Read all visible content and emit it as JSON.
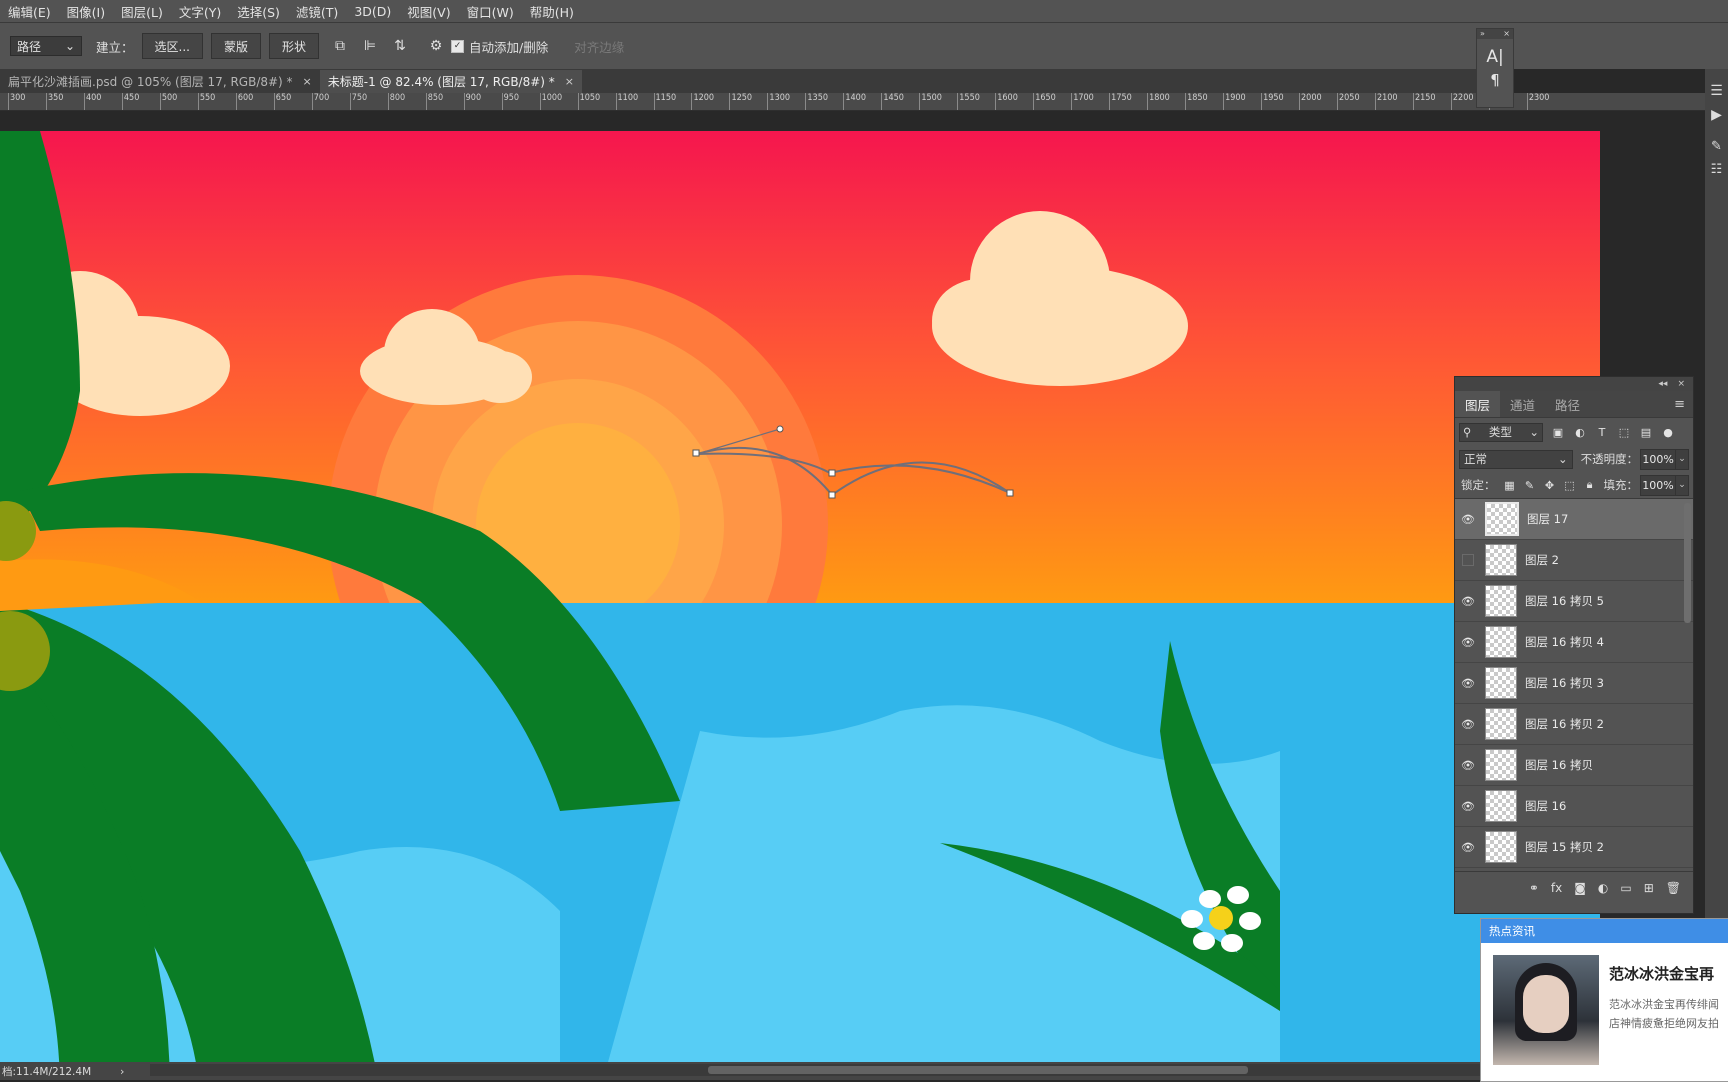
{
  "menu": [
    "编辑(E)",
    "图像(I)",
    "图层(L)",
    "文字(Y)",
    "选择(S)",
    "滤镜(T)",
    "3D(D)",
    "视图(V)",
    "窗口(W)",
    "帮助(H)"
  ],
  "options_bar": {
    "tool_mode": "路径",
    "make_label": "建立：",
    "selection_btn": "选区...",
    "mask_btn": "蒙版",
    "shape_btn": "形状",
    "auto_add_delete_checked": true,
    "auto_add_delete_label": "自动添加/删除",
    "align_edges_label": "对齐边缘"
  },
  "tabs": [
    {
      "label": "扁平化沙滩插画.psd @ 105% (图层 17, RGB/8#) *",
      "active": false
    },
    {
      "label": "未标题-1 @ 82.4% (图层 17, RGB/8#) *",
      "active": true
    }
  ],
  "ruler_ticks": [
    "300",
    "350",
    "400",
    "450",
    "500",
    "550",
    "600",
    "650",
    "700",
    "750",
    "800",
    "850",
    "900",
    "950",
    "1000",
    "1050",
    "1100",
    "1150",
    "1200",
    "1250",
    "1300",
    "1350",
    "1400",
    "1450",
    "1500",
    "1550",
    "1600",
    "1650",
    "1700",
    "1750",
    "1800",
    "1850",
    "1900",
    "1950",
    "2000",
    "2050",
    "2100",
    "2150",
    "2200",
    "2250",
    "2300"
  ],
  "status": {
    "doc_size": "档:11.4M/212.4M"
  },
  "char_panel": {
    "icons": [
      "character-icon",
      "paragraph-icon"
    ]
  },
  "layers_panel": {
    "tabs": [
      "图层",
      "通道",
      "路径"
    ],
    "kind_filter": "类型",
    "blend_mode": "正常",
    "opacity_label": "不透明度：",
    "opacity_value": "100%",
    "lock_label": "锁定：",
    "fill_label": "填充：",
    "fill_value": "100%",
    "layers": [
      {
        "name": "图层 17",
        "visible": true,
        "selected": true
      },
      {
        "name": "图层 2",
        "visible": false,
        "selected": false
      },
      {
        "name": "图层 16 拷贝 5",
        "visible": true,
        "selected": false
      },
      {
        "name": "图层 16 拷贝 4",
        "visible": true,
        "selected": false
      },
      {
        "name": "图层 16 拷贝 3",
        "visible": true,
        "selected": false
      },
      {
        "name": "图层 16 拷贝 2",
        "visible": true,
        "selected": false
      },
      {
        "name": "图层 16 拷贝",
        "visible": true,
        "selected": false
      },
      {
        "name": "图层 16",
        "visible": true,
        "selected": false
      },
      {
        "name": "图层 15 拷贝 2",
        "visible": true,
        "selected": false
      }
    ],
    "footer_icons": [
      "link-icon",
      "fx-icon",
      "mask-icon",
      "adjustment-icon",
      "folder-icon",
      "new-layer-icon",
      "trash-icon"
    ]
  },
  "news": {
    "header": "热点资讯",
    "title": "范冰冰洪金宝再",
    "body_line1": "范冰冰洪金宝再传绯闻",
    "body_line2": "店神情疲惫拒绝网友拍"
  },
  "colors": {
    "sky_top": "#f5164e",
    "sky_bottom": "#ff9a12",
    "sea": "#31b6ea",
    "leaf": "#0a7d26",
    "cloud": "#ffe0b6",
    "sun": "#ffb040"
  }
}
